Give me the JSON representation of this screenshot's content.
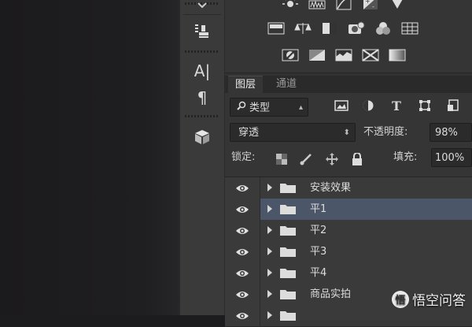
{
  "toolbar": {
    "icons": [
      "arrange-icon",
      "stamp-icon",
      "character-icon",
      "paragraph-icon",
      "3d-cube-icon"
    ],
    "character_label": "A|",
    "paragraph_label": "¶"
  },
  "adjustments": {
    "row1": [
      "brightness-icon",
      "levels-icon",
      "curves-icon",
      "exposure-icon",
      "vibrance-icon"
    ],
    "row2": [
      "hue-saturation-icon",
      "color-balance-icon",
      "black-white-icon",
      "photo-filter-icon",
      "channel-mixer-icon",
      "color-lookup-icon"
    ],
    "row3": [
      "invert-icon",
      "posterize-icon",
      "threshold-icon",
      "selective-color-icon",
      "gradient-map-icon"
    ]
  },
  "tabs": [
    {
      "label": "图层"
    },
    {
      "label": "通道"
    }
  ],
  "filter": {
    "kind_label": "类型",
    "icons": [
      "pixel-filter-icon",
      "adjustment-filter-icon",
      "type-filter-icon",
      "shape-filter-icon",
      "smart-object-filter-icon"
    ],
    "type_glyph": "T"
  },
  "blend": {
    "mode": "穿透",
    "opacity_label": "不透明度:",
    "opacity_value": "98%"
  },
  "lock": {
    "label": "锁定:",
    "fill_label": "填充:",
    "fill_value": "100%"
  },
  "layers": [
    {
      "name": "安装效果",
      "selected": false
    },
    {
      "name": "平1",
      "selected": true
    },
    {
      "name": "平2",
      "selected": false
    },
    {
      "name": "平3",
      "selected": false
    },
    {
      "name": "平4",
      "selected": false
    },
    {
      "name": "商品实拍",
      "selected": false
    },
    {
      "name": "",
      "selected": false
    }
  ],
  "watermark": {
    "logo_text": "悟",
    "text": "悟空问答"
  }
}
